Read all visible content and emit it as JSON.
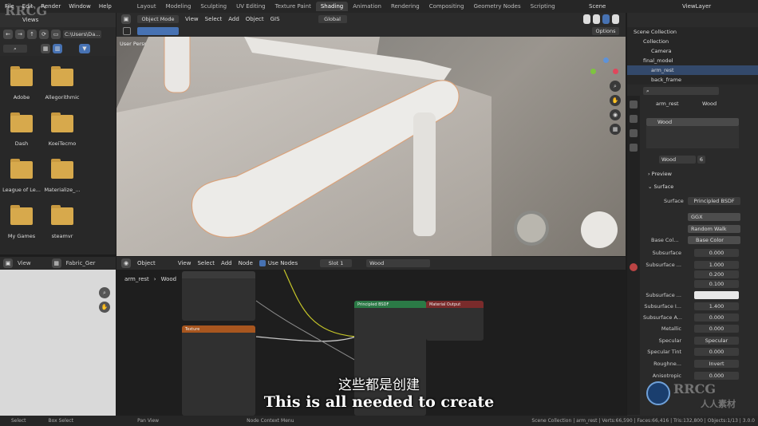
{
  "top_menu": [
    "File",
    "Edit",
    "Render",
    "Window",
    "Help"
  ],
  "workspaces": [
    "Layout",
    "Modeling",
    "Sculpting",
    "UV Editing",
    "Texture Paint",
    "Shading",
    "Animation",
    "Rendering",
    "Compositing",
    "Geometry Nodes",
    "Scripting"
  ],
  "active_workspace": "Shading",
  "scene_name": "Scene",
  "view_layer": "ViewLayer",
  "file_browser": {
    "title": "Views",
    "path": "C:\\Users\\Da...",
    "folders": [
      "Adobe",
      "Allegorithmic",
      "Dash",
      "KoeiTecmo",
      "League of Le...",
      "Materialize_...",
      "My Games",
      "steamvr"
    ]
  },
  "viewport": {
    "mode": "Object Mode",
    "menus": [
      "View",
      "Select",
      "Add",
      "Object",
      "GIS"
    ],
    "transform": "Global",
    "label": "User Perspective",
    "options": "Options"
  },
  "outliner": {
    "title": "Scene Collection",
    "rows": [
      {
        "label": "Collection",
        "selected": false
      },
      {
        "label": "Camera",
        "selected": false
      },
      {
        "label": "final_model",
        "selected": false
      },
      {
        "label": "arm_rest",
        "selected": true
      },
      {
        "label": "back_frame",
        "selected": false
      }
    ]
  },
  "properties": {
    "object": "arm_rest",
    "material": "Wood",
    "slot": "Wood",
    "material_field": "Wood",
    "users": "6",
    "preview": "Preview",
    "surface_header": "Surface",
    "surface_label": "Surface",
    "surface_value": "Principled BSDF",
    "distribution": "GGX",
    "subsurface_method": "Random Walk",
    "base_color_label": "Base Col...",
    "base_color_value": "Base Color",
    "rows": [
      {
        "label": "Subsurface",
        "value": "0.000"
      },
      {
        "label": "Subsurface ...",
        "value": "1.000"
      },
      {
        "label": "",
        "value": "0.200"
      },
      {
        "label": "",
        "value": "0.100"
      },
      {
        "label": "Subsurface ...",
        "value": ""
      },
      {
        "label": "Subsurface I...",
        "value": "1.400"
      },
      {
        "label": "Subsurface A...",
        "value": "0.000"
      },
      {
        "label": "Metallic",
        "value": "0.000"
      },
      {
        "label": "Specular",
        "value": "Specular"
      },
      {
        "label": "Specular Tint",
        "value": "0.000"
      },
      {
        "label": "Roughne...",
        "value": "Invert"
      },
      {
        "label": "Anisotropic",
        "value": "0.000"
      }
    ]
  },
  "image_editor": {
    "view": "View",
    "image": "Fabric_Ger"
  },
  "node_editor": {
    "menus": [
      "Object",
      "View",
      "Select",
      "Add",
      "Node"
    ],
    "use_nodes": "Use Nodes",
    "slot": "Slot 1",
    "material": "Wood",
    "breadcrumb": [
      "arm_rest",
      "Wood"
    ],
    "nodes": {
      "principled": "Principled BSDF",
      "output": "Material Output",
      "texture": "Texture"
    }
  },
  "status_bar": {
    "left": [
      "Select",
      "Box Select",
      "Pan View",
      "Node Context Menu"
    ],
    "right": "Scene Collection | arm_rest | Verts:66,590 | Faces:66,416 | Tris:132,800 | Objects:1/13 | 3.0.0"
  },
  "subtitles": {
    "zh": "这些都是创建",
    "en": "This is all needed to create"
  },
  "watermarks": [
    "RRCG",
    "人人素材"
  ]
}
